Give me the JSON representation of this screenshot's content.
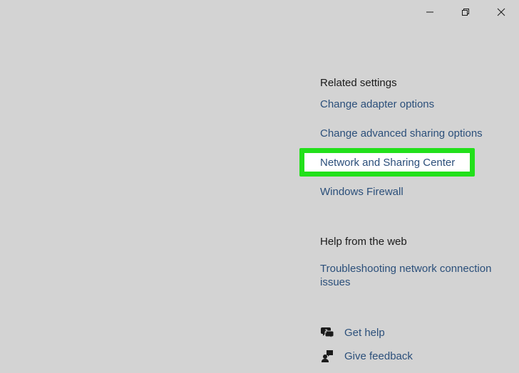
{
  "window_controls": {
    "minimize": "minimize-icon",
    "restore": "restore-icon",
    "close": "close-icon"
  },
  "related_settings": {
    "heading": "Related settings",
    "links": [
      "Change adapter options",
      "Change advanced sharing options",
      "Network and Sharing Center",
      "Windows Firewall"
    ],
    "highlighted_index": 2,
    "highlight_color": "#22e01a"
  },
  "help_from_web": {
    "heading": "Help from the web",
    "link": "Troubleshooting network connection issues"
  },
  "actions": {
    "get_help": {
      "label": "Get help",
      "icon": "chat-help-icon"
    },
    "give_feedback": {
      "label": "Give feedback",
      "icon": "feedback-icon"
    }
  },
  "colors": {
    "background": "#d3d3d3",
    "link": "#2b4f7a"
  }
}
